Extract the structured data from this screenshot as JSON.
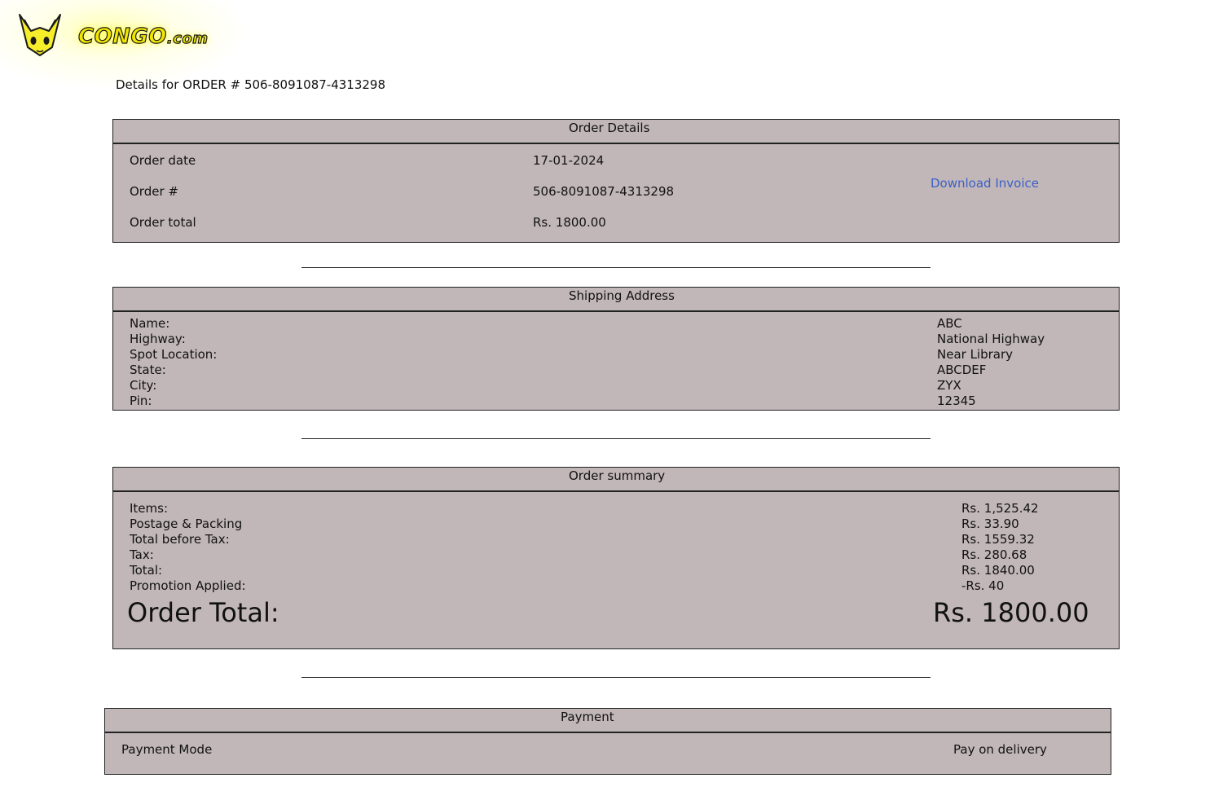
{
  "logo": {
    "text_main": "CONGO",
    "text_suffix": ".com"
  },
  "heading": {
    "prefix": "Details for ORDER # ",
    "order_id": "506-8091087-4313298"
  },
  "order_details": {
    "title": "Order Details",
    "date_label": "Order date",
    "date_value": "17-01-2024",
    "number_label": "Order #",
    "number_value": "506-8091087-4313298",
    "total_label": "Order total",
    "total_value": "Rs. 1800.00",
    "download_label": "Download Invoice"
  },
  "shipping": {
    "title": "Shipping Address",
    "rows": [
      {
        "label": "Name:",
        "value": "ABC"
      },
      {
        "label": "Highway:",
        "value": "National Highway"
      },
      {
        "label": "Spot Location:",
        "value": "Near Library"
      },
      {
        "label": "State:",
        "value": "ABCDEF"
      },
      {
        "label": "City:",
        "value": "ZYX"
      },
      {
        "label": "Pin:",
        "value": "12345"
      }
    ]
  },
  "summary": {
    "title": "Order summary",
    "rows": [
      {
        "label": "Items:",
        "value": "Rs. 1,525.42"
      },
      {
        "label": "Postage & Packing",
        "value": "Rs. 33.90"
      },
      {
        "label": "Total before Tax:",
        "value": "Rs. 1559.32"
      },
      {
        "label": "Tax:",
        "value": "Rs. 280.68"
      },
      {
        "label": "Total:",
        "value": "Rs. 1840.00"
      },
      {
        "label": "Promotion Applied:",
        "value": "-Rs. 40"
      }
    ],
    "grand_label": "Order Total:",
    "grand_value": "Rs. 1800.00"
  },
  "payment": {
    "title": "Payment",
    "mode_label": "Payment Mode",
    "mode_value": "Pay on delivery"
  },
  "colors": {
    "panel_bg": "#c1b7b8",
    "link": "#3b5fc8",
    "logo_yellow": "#f2e600"
  }
}
